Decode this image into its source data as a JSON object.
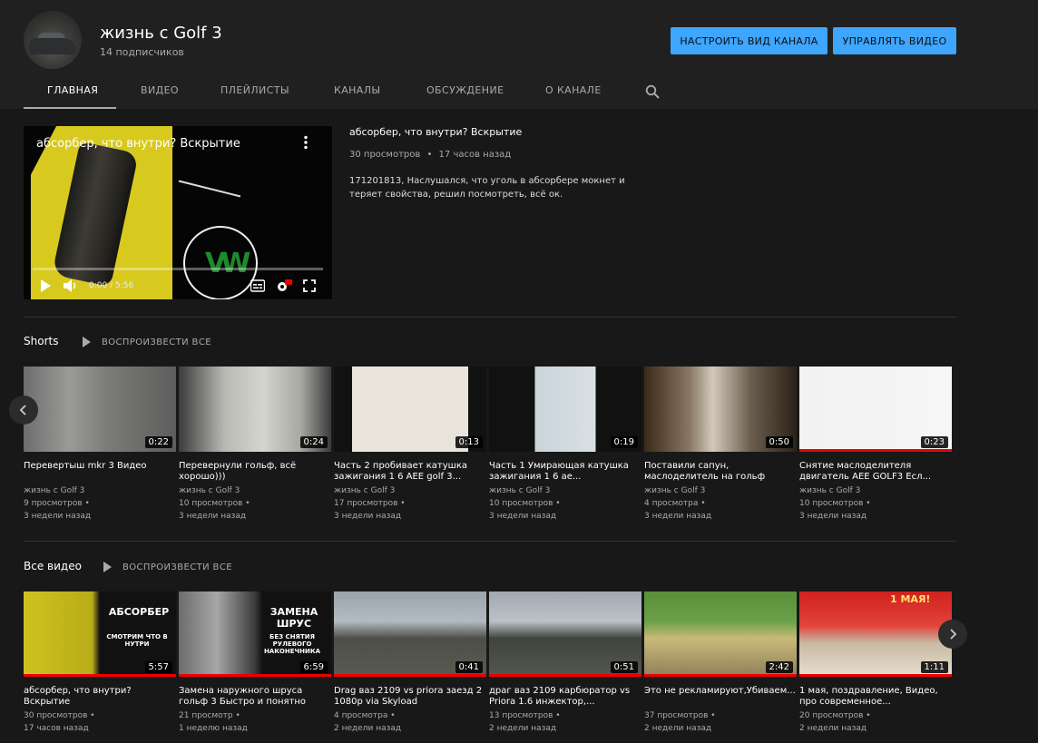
{
  "channel": {
    "name": "жизнь с Golf 3",
    "subscribers": "14 подписчиков",
    "customize_label": "НАСТРОИТЬ ВИД КАНАЛА",
    "manage_label": "УПРАВЛЯТЬ ВИДЕО"
  },
  "tabs": [
    {
      "label": "ГЛАВНАЯ",
      "active": true
    },
    {
      "label": "ВИДЕО",
      "active": false
    },
    {
      "label": "ПЛЕЙЛИСТЫ",
      "active": false
    },
    {
      "label": "КАНАЛЫ",
      "active": false
    },
    {
      "label": "ОБСУЖДЕНИЕ",
      "active": false
    },
    {
      "label": "О КАНАЛЕ",
      "active": false
    }
  ],
  "featured": {
    "player_title": "абсорбер, что внутри? Вскрытие",
    "time": "0:00 / 5:56",
    "progress": 0,
    "title": "абсорбер, что внутри? Вскрытие",
    "views": "30 просмотров",
    "age": "17 часов назад",
    "description": "171201813, Наслушался, что уголь в абсорбере мокнет и теряет свойства, решил посмотреть, всё ок."
  },
  "shorts": {
    "title": "Shorts",
    "play_all": "ВОСПРОИЗВЕСТИ ВСЕ",
    "items": [
      {
        "title": "Перевертыш mkr 3 Видео",
        "channel": "жизнь с Golf 3",
        "views": "9 просмотров",
        "age": "3 недели назад",
        "duration": "0:22",
        "watched": false
      },
      {
        "title": "Перевернули гольф, всё хорошо)))",
        "channel": "жизнь с Golf 3",
        "views": "10 просмотров",
        "age": "3 недели назад",
        "duration": "0:24",
        "watched": false
      },
      {
        "title": "Часть 2 пробивает катушка зажигания 1 6 AEE golf 3...",
        "channel": "жизнь с Golf 3",
        "views": "17 просмотров",
        "age": "3 недели назад",
        "duration": "0:13",
        "watched": false
      },
      {
        "title": "Часть 1 Умирающая катушка зажигания 1 6 ae...",
        "channel": "жизнь с Golf 3",
        "views": "10 просмотров",
        "age": "3 недели назад",
        "duration": "0:19",
        "watched": false
      },
      {
        "title": "Поставили сапун, маслоделитель на гольф",
        "channel": "жизнь с Golf 3",
        "views": "4 просмотра",
        "age": "3 недели назад",
        "duration": "0:50",
        "watched": false
      },
      {
        "title": "Снятие маслоделителя двигатель AEE GOLF3 Есл...",
        "channel": "жизнь с Golf 3",
        "views": "10 просмотров",
        "age": "3 недели назад",
        "duration": "0:23",
        "watched": true
      }
    ]
  },
  "all_videos": {
    "title": "Все видео",
    "play_all": "ВОСПРОИЗВЕСТИ ВСЕ",
    "items": [
      {
        "title": "абсорбер, что внутри? Вскрытие",
        "views": "30 просмотров",
        "age": "17 часов назад",
        "duration": "5:57",
        "thumb_text": [
          "АБСОРБЕР",
          "СМОТРИМ ЧТО В НУТРИ"
        ],
        "watched": true
      },
      {
        "title": "Замена наружного шруса гольф 3 Быстро и понятно",
        "views": "21 просмотр",
        "age": "1 неделю назад",
        "duration": "6:59",
        "thumb_text": [
          "ЗАМЕНА ШРУС",
          "БЕЗ СНЯТИЯ РУЛЕВОГО НАКОНЕЧНИКА"
        ],
        "watched": true
      },
      {
        "title": "Drag ваз 2109 vs priora заезд 2 1080p via Skyload",
        "views": "4 просмотра",
        "age": "2 недели назад",
        "duration": "0:41",
        "watched": true
      },
      {
        "title": "драг ваз 2109 карбюратор vs Priora 1.6 инжектор,...",
        "views": "13 просмотров",
        "age": "2 недели назад",
        "duration": "0:51",
        "watched": true
      },
      {
        "title": "Это не рекламируют,Убиваем...",
        "views": "37 просмотров",
        "age": "2 недели назад",
        "duration": "2:42",
        "watched": true
      },
      {
        "title": "1 мая, поздравление, Видео, про современное...",
        "views": "20 просмотров",
        "age": "2 недели назад",
        "duration": "1:11",
        "thumb_text": [
          "1 МАЯ!"
        ],
        "watched": true
      }
    ]
  },
  "colors": {
    "accent": "#3ea6ff",
    "background": "#181818",
    "header": "#202020",
    "watched_bar": "#ee0000"
  }
}
